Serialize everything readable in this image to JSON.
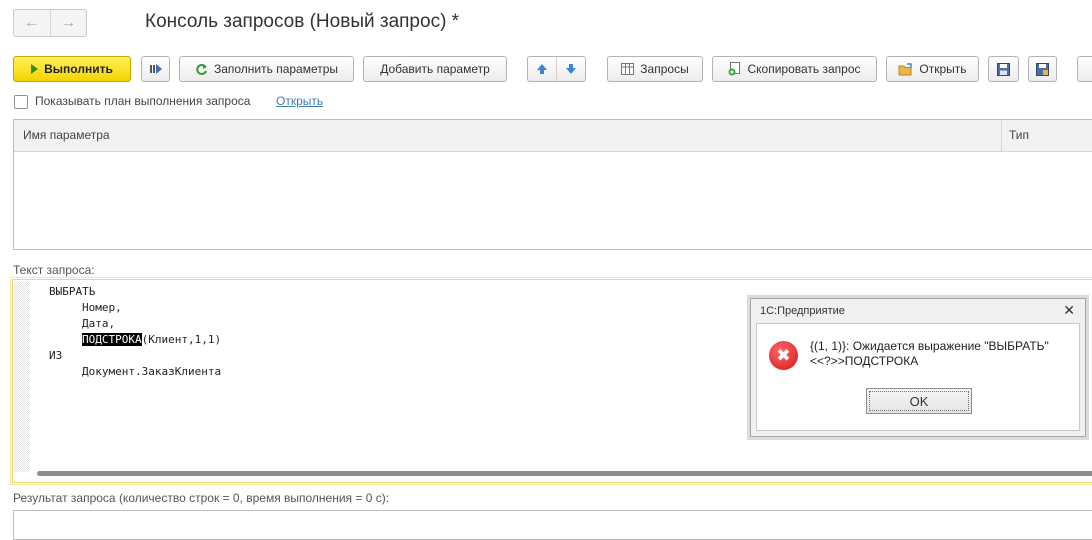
{
  "window": {
    "title": "Консоль запросов (Новый запрос) *",
    "back_icon": "←",
    "forward_icon": "→"
  },
  "toolbar": {
    "execute_label": "Выполнить",
    "fill_params_label": "Заполнить параметры",
    "add_param_label": "Добавить параметр",
    "queries_label": "Запросы",
    "copy_query_label": "Скопировать запрос",
    "open_label": "Открыть"
  },
  "options": {
    "show_plan_label": "Показывать план выполнения запроса",
    "show_plan_checked": false,
    "open_link": "Открыть"
  },
  "params_table": {
    "columns": [
      "Имя параметра",
      "Тип"
    ]
  },
  "query": {
    "label": "Текст запроса:",
    "lines": [
      "ВЫБРАТЬ",
      "Номер,",
      "Дата,",
      "(Клиент,1,1)",
      "ИЗ",
      "Документ.ЗаказКлиента"
    ],
    "highlighted": "ПОДСТРОКА"
  },
  "result": {
    "label": "Результат запроса (количество строк = 0, время выполнения = 0 с):"
  },
  "dialog": {
    "title": "1С:Предприятие",
    "close_icon": "✕",
    "message_line1": "{(1, 1)}: Ожидается выражение \"ВЫБРАТЬ\"",
    "message_line2": "<<?>>ПОДСТРОКА",
    "ok_label": "OK",
    "error_icon": "✖"
  },
  "colors": {
    "primary_button": "#f4d400",
    "link": "#3c7fb1",
    "error": "#d11414"
  }
}
